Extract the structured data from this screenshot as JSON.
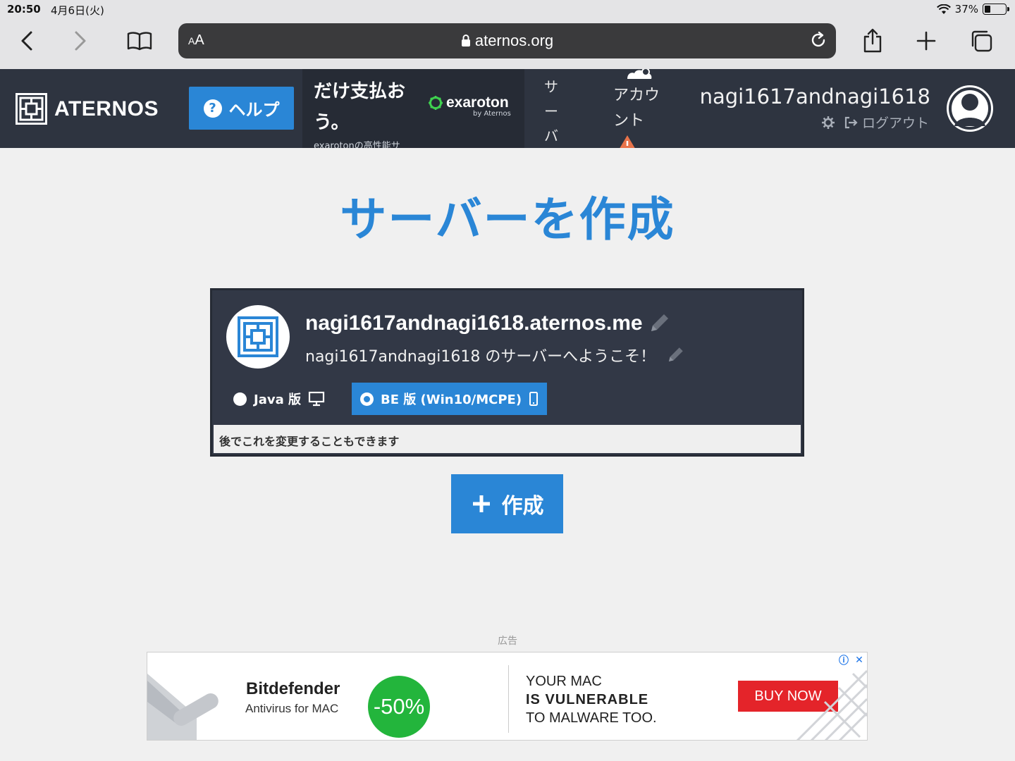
{
  "status": {
    "time": "20:50",
    "date": "4月6日(火)",
    "battery": "37%"
  },
  "browser": {
    "text_size": "AA",
    "host": "aternos.org"
  },
  "nav": {
    "logo": "ATERNOS",
    "help": "ヘルプ",
    "promo_title": "だけ支払おう。",
    "promo_sub": "exarotonの高性能サ",
    "promo_brand": "exaroton",
    "promo_brand_sub": "by Aternos",
    "server_tab": "サーバ",
    "account_tab": "アカウント",
    "username": "nagi1617andnagi1618",
    "logout": "ログアウト"
  },
  "main": {
    "title": "サーバーを作成",
    "server_address": "nagi1617andnagi1618.aternos.me",
    "motd": "nagi1617andnagi1618 のサーバーへようこそ！",
    "edition_java": "Java 版",
    "edition_be": "BE 版 (Win10/MCPE)",
    "selected_edition": "BE 版 (Win10/MCPE)",
    "note": "後でこれを変更することもできます",
    "create": "作成"
  },
  "ad": {
    "label": "広告",
    "brand": "Bitdefender",
    "product": "Antivirus for MAC",
    "discount": "-50%",
    "line1": "YOUR MAC",
    "line2": "IS VULNERABLE",
    "line3": "TO MALWARE TOO.",
    "cta": "BUY NOW",
    "accent": "#e4242a"
  },
  "colors": {
    "brand_blue": "#2a86d6",
    "nav_bg": "#2e3440",
    "card_bg": "#323846"
  }
}
